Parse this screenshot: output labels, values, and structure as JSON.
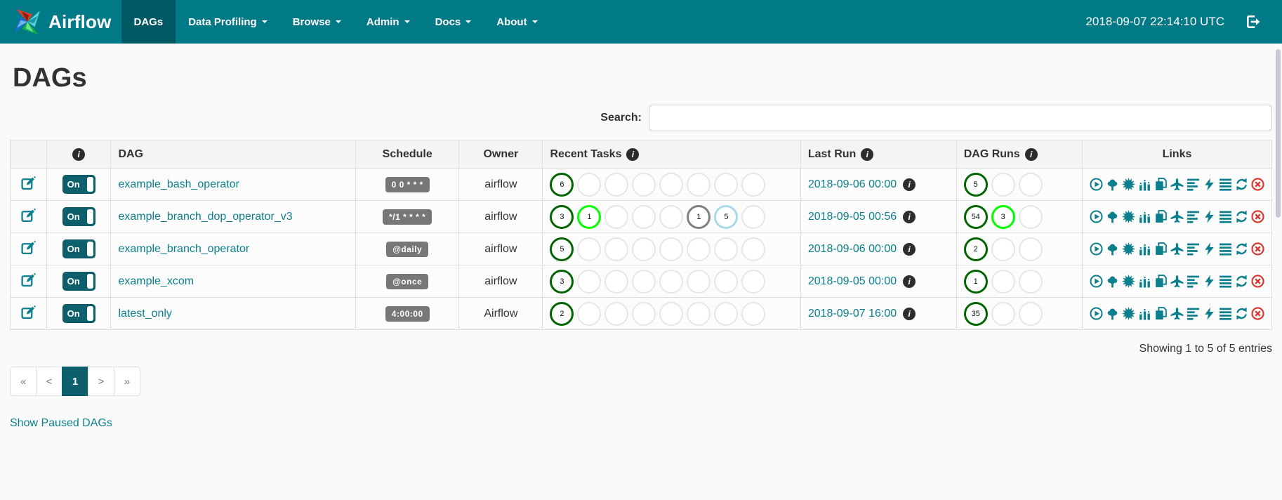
{
  "navbar": {
    "brand": "Airflow",
    "items": [
      {
        "label": "DAGs",
        "active": true,
        "caret": false
      },
      {
        "label": "Data Profiling",
        "active": false,
        "caret": true
      },
      {
        "label": "Browse",
        "active": false,
        "caret": true
      },
      {
        "label": "Admin",
        "active": false,
        "caret": true
      },
      {
        "label": "Docs",
        "active": false,
        "caret": true
      },
      {
        "label": "About",
        "active": false,
        "caret": true
      }
    ],
    "clock": "2018-09-07 22:14:10 UTC",
    "logout_icon": "sign-out-icon"
  },
  "page": {
    "title": "DAGs",
    "search_label": "Search:",
    "search_value": "",
    "showing_text": "Showing 1 to 5 of 5 entries",
    "show_paused_label": "Show Paused DAGs"
  },
  "table": {
    "headers": {
      "edit": "",
      "info": "i",
      "dag": "DAG",
      "schedule": "Schedule",
      "owner": "Owner",
      "recent_tasks": "Recent Tasks",
      "last_run": "Last Run",
      "dag_runs": "DAG Runs",
      "links": "Links"
    },
    "rows": [
      {
        "toggle": "On",
        "dag": "example_bash_operator",
        "schedule": "0 0 * * *",
        "owner": "airflow",
        "recent_tasks": [
          {
            "count": "6",
            "state": "success"
          },
          {
            "state": "empty"
          },
          {
            "state": "empty"
          },
          {
            "state": "empty"
          },
          {
            "state": "empty"
          },
          {
            "state": "empty"
          },
          {
            "state": "empty"
          },
          {
            "state": "empty"
          }
        ],
        "last_run": "2018-09-06 00:00",
        "dag_runs": [
          {
            "count": "5",
            "state": "success"
          },
          {
            "state": "empty"
          },
          {
            "state": "empty"
          }
        ]
      },
      {
        "toggle": "On",
        "dag": "example_branch_dop_operator_v3",
        "schedule": "*/1 * * * *",
        "owner": "airflow",
        "recent_tasks": [
          {
            "count": "3",
            "state": "success"
          },
          {
            "count": "1",
            "state": "running"
          },
          {
            "state": "empty"
          },
          {
            "state": "empty"
          },
          {
            "state": "empty"
          },
          {
            "count": "1",
            "state": "queued"
          },
          {
            "count": "5",
            "state": "none"
          },
          {
            "state": "empty"
          }
        ],
        "last_run": "2018-09-05 00:56",
        "dag_runs": [
          {
            "count": "54",
            "state": "success"
          },
          {
            "count": "3",
            "state": "running"
          },
          {
            "state": "empty"
          }
        ]
      },
      {
        "toggle": "On",
        "dag": "example_branch_operator",
        "schedule": "@daily",
        "owner": "airflow",
        "recent_tasks": [
          {
            "count": "5",
            "state": "success"
          },
          {
            "state": "empty"
          },
          {
            "state": "empty"
          },
          {
            "state": "empty"
          },
          {
            "state": "empty"
          },
          {
            "state": "empty"
          },
          {
            "state": "empty"
          },
          {
            "state": "empty"
          }
        ],
        "last_run": "2018-09-06 00:00",
        "dag_runs": [
          {
            "count": "2",
            "state": "success"
          },
          {
            "state": "empty"
          },
          {
            "state": "empty"
          }
        ]
      },
      {
        "toggle": "On",
        "dag": "example_xcom",
        "schedule": "@once",
        "owner": "airflow",
        "recent_tasks": [
          {
            "count": "3",
            "state": "success"
          },
          {
            "state": "empty"
          },
          {
            "state": "empty"
          },
          {
            "state": "empty"
          },
          {
            "state": "empty"
          },
          {
            "state": "empty"
          },
          {
            "state": "empty"
          },
          {
            "state": "empty"
          }
        ],
        "last_run": "2018-09-05 00:00",
        "dag_runs": [
          {
            "count": "1",
            "state": "success"
          },
          {
            "state": "empty"
          },
          {
            "state": "empty"
          }
        ]
      },
      {
        "toggle": "On",
        "dag": "latest_only",
        "schedule": "4:00:00",
        "owner": "Airflow",
        "recent_tasks": [
          {
            "count": "2",
            "state": "success"
          },
          {
            "state": "empty"
          },
          {
            "state": "empty"
          },
          {
            "state": "empty"
          },
          {
            "state": "empty"
          },
          {
            "state": "empty"
          },
          {
            "state": "empty"
          },
          {
            "state": "empty"
          }
        ],
        "last_run": "2018-09-07 16:00",
        "dag_runs": [
          {
            "count": "35",
            "state": "success"
          },
          {
            "state": "empty"
          },
          {
            "state": "empty"
          }
        ]
      }
    ],
    "links_icons": [
      "trigger-dag-icon",
      "tree-view-icon",
      "graph-view-icon",
      "task-duration-icon",
      "task-tries-icon",
      "landing-times-icon",
      "gantt-view-icon",
      "code-view-icon",
      "dag-details-icon",
      "refresh-icon",
      "delete-dag-icon"
    ]
  },
  "pagination": {
    "items": [
      {
        "label": "«",
        "active": false
      },
      {
        "label": "<",
        "active": false
      },
      {
        "label": "1",
        "active": true
      },
      {
        "label": ">",
        "active": false
      },
      {
        "label": "»",
        "active": false
      }
    ]
  },
  "colors": {
    "navbar_bg": "#007A87",
    "navbar_active_bg": "#015964",
    "link_teal": "#0C7F8C",
    "badge_gray": "#777777",
    "delete_red": "#d9342b",
    "states": {
      "success": "#006400",
      "running": "#00FF00",
      "queued": "#808080",
      "none": "#A9D9E8",
      "empty": "#e6e6e6"
    }
  }
}
